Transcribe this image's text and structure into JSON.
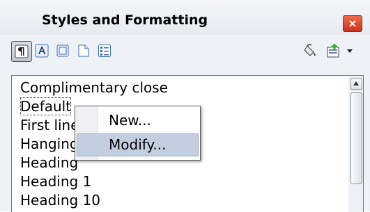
{
  "window": {
    "title": "Styles and Formatting",
    "close_label": "×"
  },
  "toolbar": {
    "buttons": [
      {
        "icon": "paragraph-styles-icon",
        "active": true
      },
      {
        "icon": "character-styles-icon"
      },
      {
        "icon": "frame-styles-icon"
      },
      {
        "icon": "page-styles-icon"
      },
      {
        "icon": "list-styles-icon"
      },
      {
        "icon": "fill-format-mode-icon"
      },
      {
        "icon": "new-style-from-selection-icon"
      }
    ]
  },
  "style_list": {
    "items": [
      "Complimentary close",
      "Default",
      "First line indent",
      "Hanging indent",
      "Heading",
      "Heading 1",
      "Heading 10"
    ],
    "selected": "Default"
  },
  "context_menu": {
    "items": [
      "New...",
      "Modify..."
    ],
    "hovered": "Modify..."
  }
}
